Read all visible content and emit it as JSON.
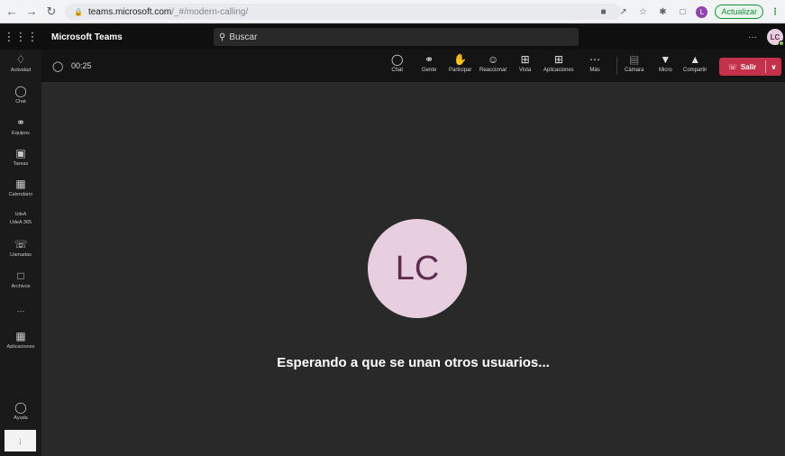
{
  "browser": {
    "url_host": "teams.microsoft.com",
    "url_path": "/_#/modern-calling/",
    "update_label": "Actualizar",
    "profile_initial": "L"
  },
  "header": {
    "app_name": "Microsoft Teams",
    "search_placeholder": "Buscar",
    "more": "···",
    "avatar_initials": "LC"
  },
  "rail": {
    "items": [
      {
        "label": "Actividad",
        "icon": "bell-icon"
      },
      {
        "label": "Chat",
        "icon": "chat-icon"
      },
      {
        "label": "Equipos",
        "icon": "teams-icon"
      },
      {
        "label": "Tareas",
        "icon": "tasks-icon"
      },
      {
        "label": "Calendario",
        "icon": "calendar-icon"
      },
      {
        "label": "UdeA 365",
        "icon": "udea-icon",
        "icon_text": "UdeA"
      },
      {
        "label": "Llamadas",
        "icon": "phone-icon"
      },
      {
        "label": "Archivos",
        "icon": "file-icon"
      },
      {
        "label": "Aplicaciones",
        "icon": "apps-icon"
      },
      {
        "label": "Ayuda",
        "icon": "help-icon"
      }
    ],
    "more": "···"
  },
  "call_bar": {
    "timer": "00:25",
    "controls": [
      {
        "label": "Chat",
        "icon": "chat-icon"
      },
      {
        "label": "Gente",
        "icon": "people-icon"
      },
      {
        "label": "Participar",
        "icon": "raise-hand-icon"
      },
      {
        "label": "Reaccionar",
        "icon": "smiley-icon"
      },
      {
        "label": "Vista",
        "icon": "grid-view-icon"
      },
      {
        "label": "Aplicaciones",
        "icon": "apps-add-icon"
      },
      {
        "label": "Más",
        "icon": "more-icon"
      },
      {
        "label": "Cámara",
        "icon": "camera-off-icon"
      },
      {
        "label": "Micro",
        "icon": "mic-icon"
      },
      {
        "label": "Compartir",
        "icon": "share-icon"
      }
    ],
    "leave_label": "Salir",
    "leave_color": "#c4314b"
  },
  "stage": {
    "avatar_initials": "LC",
    "waiting_text": "Esperando a que se unan otros usuarios..."
  }
}
